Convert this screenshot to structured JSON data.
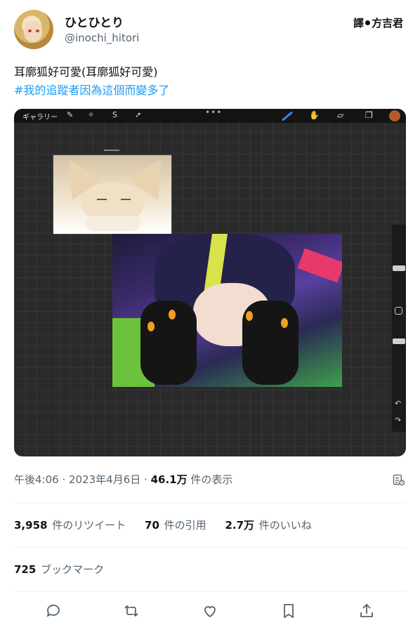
{
  "author": {
    "display_name": "ひとひとり",
    "handle": "@inochi_hitori"
  },
  "stamp": {
    "left": "譯",
    "right": "方吉君"
  },
  "tweet": {
    "line1": "耳廓狐好可愛(耳廓狐好可愛)",
    "hashtag": "#我的追蹤者因為這個而變多了"
  },
  "media": {
    "toolbar_gallery": "ギャラリー",
    "toolbar_dots": "•••",
    "accent_color": "#1d9bf0",
    "brush_color": "#2a8cf0",
    "swatch_color": "#b55a2a"
  },
  "meta": {
    "time": "午後4:06",
    "sep1": " · ",
    "date": "2023年4月6日",
    "sep2": " · ",
    "views_count": "46.1万",
    "views_label": " 件の表示"
  },
  "stats": {
    "retweets_count": "3,958",
    "retweets_label": " 件のリツイート",
    "quotes_count": "70",
    "quotes_label": " 件の引用",
    "likes_count": "2.7万",
    "likes_label": " 件のいいね"
  },
  "bookmarks": {
    "count": "725",
    "label": " ブックマーク"
  },
  "actions": [
    "reply-icon",
    "retweet-icon",
    "like-icon",
    "bookmark-icon",
    "share-icon"
  ]
}
